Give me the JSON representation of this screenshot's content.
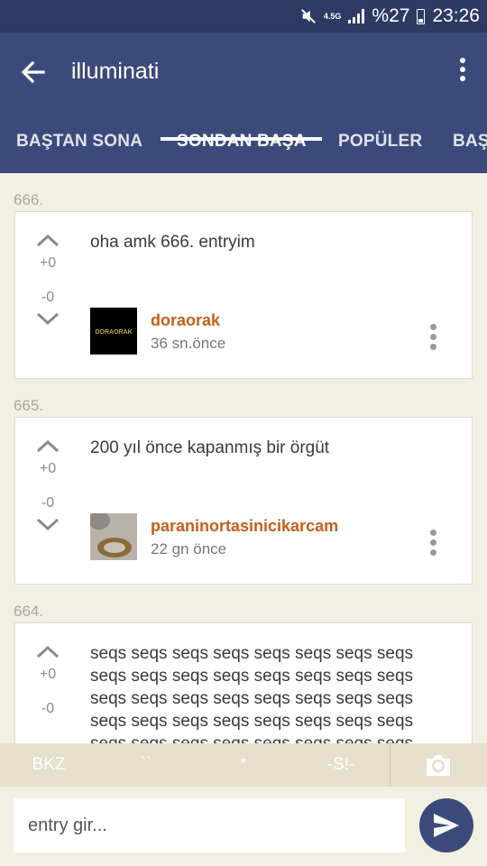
{
  "status_bar": {
    "network": "4.5G",
    "battery": "%27",
    "time": "23:26"
  },
  "app_bar": {
    "title": "illuminati"
  },
  "tabs": [
    {
      "label": "BAŞTAN SONA"
    },
    {
      "label": "SONDAN BAŞA",
      "active": true
    },
    {
      "label": "POPÜLER"
    },
    {
      "label": "BAŞ"
    }
  ],
  "entries": [
    {
      "number": "666.",
      "text": "oha amk 666. entryim",
      "up": "+0",
      "down": "-0",
      "author": "doraorak",
      "time": "36 sn.önce",
      "avatar_text": "DORAORAK"
    },
    {
      "number": "665.",
      "text": "200 yıl önce kapanmış bir örgüt",
      "up": "+0",
      "down": "-0",
      "author": "paraninortasinicikarcam",
      "time": "22 gn  önce"
    },
    {
      "number": "664.",
      "text_lines": [
        "seqs seqs seqs seqs seqs seqs seqs seqs",
        "seqs seqs seqs seqs seqs seqs seqs seqs",
        "seqs seqs seqs seqs seqs seqs seqs seqs",
        "seqs seqs seqs seqs seqs seqs seqs seqs",
        "seqs seqs seqs seqs seqs seqs seqs seqs"
      ],
      "up": "+0",
      "down": "-0"
    }
  ],
  "toolbar": {
    "bkz": "BKZ",
    "backtick": "``",
    "star": "*",
    "spoiler": "-S!-"
  },
  "input": {
    "placeholder": "entry gir..."
  },
  "colors": {
    "primary": "#3b4a7a",
    "status_bar": "#2d3a63",
    "author": "#c5601a",
    "background": "#f2efe3"
  }
}
